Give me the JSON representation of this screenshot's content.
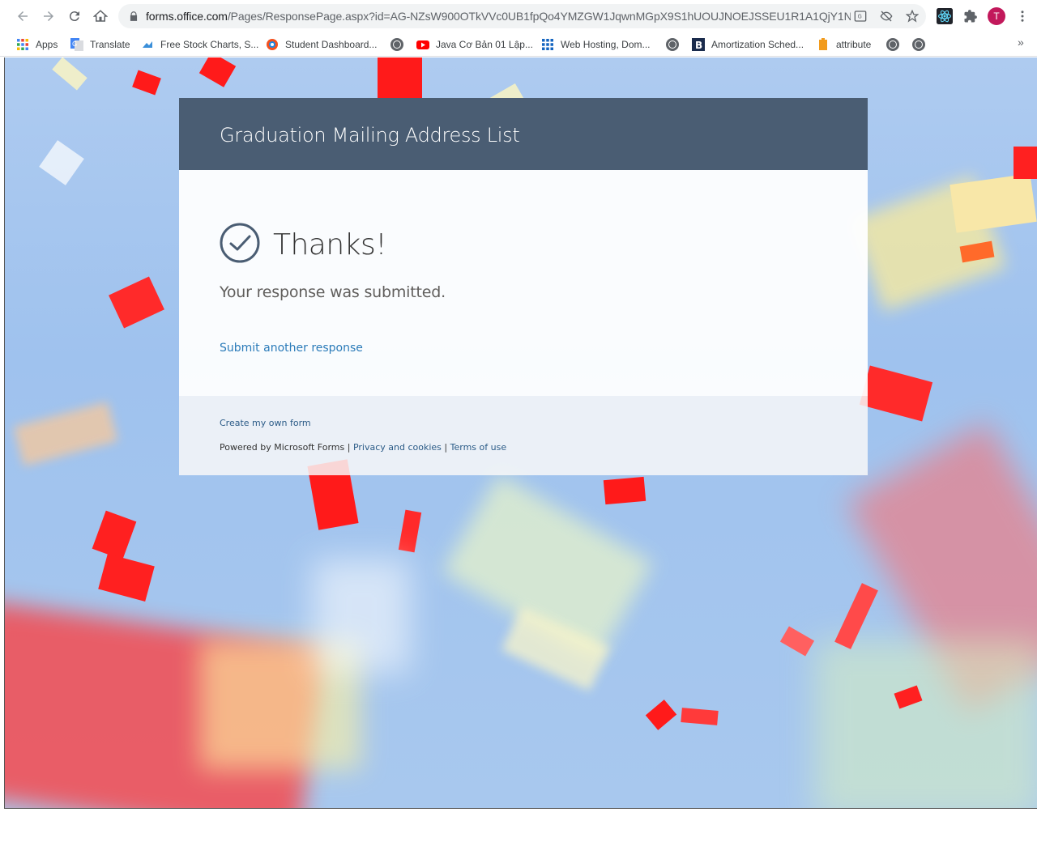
{
  "browser": {
    "url_host": "forms.office.com",
    "url_path": "/Pages/ResponsePage.aspx?id=AG-NZsW900OTkVVc0UB1fpQo4YMZGW1JqwnMGpX9S1hUOUJNOEJSSEU1R1A1QjY1ND...",
    "avatar_letter": "T",
    "bookmarks": [
      {
        "label": "Apps",
        "icon": "apps-grid-icon"
      },
      {
        "label": "Translate",
        "icon": "google-translate-icon"
      },
      {
        "label": "Free Stock Charts, S...",
        "icon": "chart-cloud-icon"
      },
      {
        "label": "Student Dashboard...",
        "icon": "student-dashboard-icon"
      },
      {
        "label": "",
        "icon": "globe-icon"
      },
      {
        "label": "Java Cơ Bản 01 Lập...",
        "icon": "youtube-icon"
      },
      {
        "label": "Web Hosting, Dom...",
        "icon": "grid-icon"
      },
      {
        "label": "",
        "icon": "globe-icon"
      },
      {
        "label": "Amortization Sched...",
        "icon": "b-icon"
      },
      {
        "label": "attribute",
        "icon": "bookmark-orange-icon"
      },
      {
        "label": "",
        "icon": "globe-icon"
      },
      {
        "label": "",
        "icon": "globe-icon"
      }
    ],
    "more_bookmarks": "»"
  },
  "form": {
    "title": "Graduation Mailing Address List",
    "thanks": "Thanks!",
    "submitted": "Your response was submitted.",
    "submit_another": "Submit another response"
  },
  "footer": {
    "create_own": "Create my own form",
    "powered_by": "Powered by Microsoft Forms",
    "separator": "|",
    "privacy": "Privacy and cookies",
    "terms": "Terms of use"
  },
  "colors": {
    "header_bg": "#4a5d73",
    "link": "#2b7bb9",
    "sky": "#a8c8ee"
  }
}
